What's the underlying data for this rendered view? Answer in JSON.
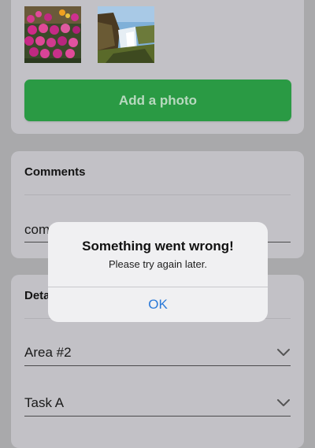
{
  "photos": {
    "add_button_label": "Add a photo",
    "thumbnails": [
      {
        "icon": "flowers-photo"
      },
      {
        "icon": "waterfall-photo"
      }
    ]
  },
  "comments": {
    "title": "Comments",
    "value": "com"
  },
  "details": {
    "title": "Deta",
    "area_value": "Area #2",
    "task_value": "Task A"
  },
  "alert": {
    "title": "Something went wrong!",
    "message": "Please try again later.",
    "ok_label": "OK"
  },
  "colors": {
    "accent_green": "#2a9a44",
    "link_blue": "#2a79d8"
  }
}
